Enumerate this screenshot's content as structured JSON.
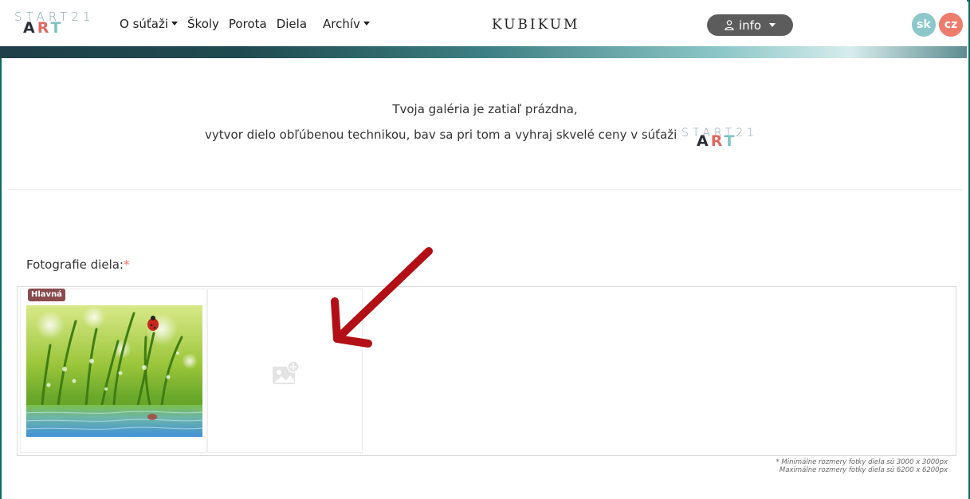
{
  "nav": {
    "logo_top": "START21",
    "logo_art": {
      "a": "A",
      "r": "R",
      "t": "T"
    },
    "menu": [
      {
        "label": "O súťaži",
        "dropdown": true
      },
      {
        "label": "Školy",
        "dropdown": false
      },
      {
        "label": "Porota",
        "dropdown": false
      },
      {
        "label": "Diela",
        "dropdown": false
      },
      {
        "label": "Archív",
        "dropdown": true
      }
    ],
    "brand": "KUBIKUM",
    "user_label": "info",
    "user_icon": "person-icon",
    "languages": [
      "sk",
      "cz"
    ],
    "colors": {
      "lang_sk": "#8cc7cb",
      "lang_cz": "#ee7c6d",
      "user_btn": "#5c5c5c",
      "frame": "#0f6b63"
    }
  },
  "gallery": {
    "empty_line1": "Tvoja galéria je zatiaľ prázdna,",
    "empty_line2": "vytvor dielo obľúbenou technikou, bav sa pri tom a vyhraj skvelé ceny v súťaži"
  },
  "photos": {
    "label": "Fotografie diela:",
    "required_mark": "*",
    "main_badge": "Hlavná",
    "add_icon": "add-image-icon",
    "note_line1": "* Minimálne rozmery fotky diela sú 3000 x 3000px",
    "note_line2": "Maximálne rozmery fotky diela sú 6200 x 6200px"
  },
  "annotation": {
    "arrow_color": "#b30f16"
  }
}
